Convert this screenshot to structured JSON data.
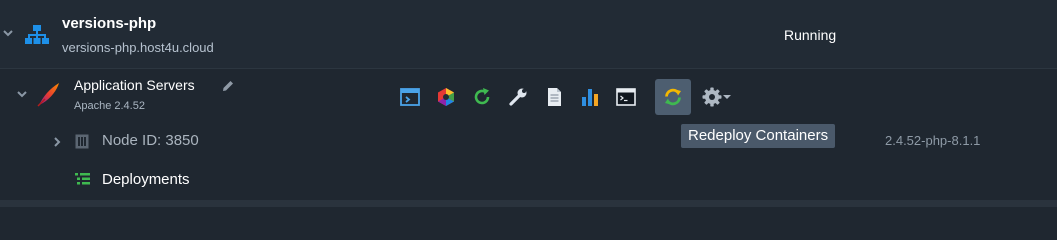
{
  "environment": {
    "name": "versions-php",
    "domain": "versions-php.host4u.cloud",
    "status": "Running"
  },
  "layer": {
    "name": "Application Servers",
    "version": "Apache 2.4.52"
  },
  "toolbar": {
    "items": [
      {
        "icon": "open-in-browser-icon"
      },
      {
        "icon": "add-ons-icon"
      },
      {
        "icon": "restart-icon"
      },
      {
        "icon": "settings-wrench-icon"
      },
      {
        "icon": "log-icon"
      },
      {
        "icon": "statistics-icon"
      },
      {
        "icon": "web-ssh-icon"
      },
      {
        "icon": "redeploy-icon",
        "active": true
      },
      {
        "icon": "more-settings-icon"
      }
    ],
    "tooltip": "Redeploy Containers"
  },
  "node": {
    "label": "Node ID: 3850",
    "tag": "2.4.52-php-8.1.1"
  },
  "deployments": {
    "label": "Deployments"
  },
  "colors": {
    "background": "#1f2730",
    "header_background": "#222b35",
    "accent_green": "#3fb950",
    "tooltip_background": "#4a596a"
  }
}
